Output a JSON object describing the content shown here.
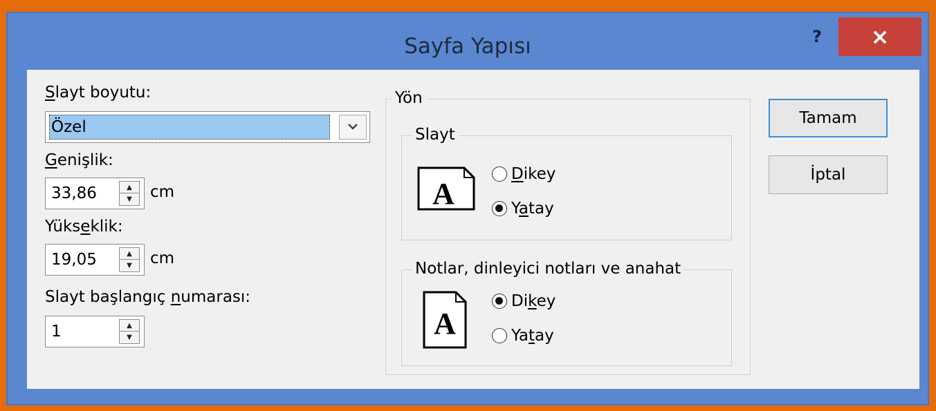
{
  "dialog": {
    "title": "Sayfa Yapısı",
    "help_label": "?",
    "close_label": "×"
  },
  "slide_size": {
    "label_prefix": "S",
    "label_rest": "layt boyutu:",
    "value": "Özel",
    "dropdown_icon": "chevron-down-icon"
  },
  "width": {
    "label_prefix": "G",
    "label_rest": "enişlik:",
    "value": "33,86",
    "unit": "cm"
  },
  "height": {
    "label_a": "Yüks",
    "label_u": "e",
    "label_b": "klik:",
    "value": "19,05",
    "unit": "cm"
  },
  "start_number": {
    "label_a": "Slayt başlangıç ",
    "label_u": "n",
    "label_b": "umarası:",
    "value": "1"
  },
  "orientation": {
    "group_label": "Yön",
    "slide": {
      "group_label": "Slayt",
      "icon_letter": "A",
      "portrait_u": "D",
      "portrait_rest": "ikey",
      "landscape_a": "Y",
      "landscape_u": "a",
      "landscape_b": "tay",
      "selected": "landscape"
    },
    "notes": {
      "group_label": "Notlar, dinleyici notları ve anahat",
      "icon_letter": "A",
      "portrait_a": "Di",
      "portrait_u": "k",
      "portrait_b": "ey",
      "landscape_a": "Ya",
      "landscape_u": "t",
      "landscape_b": "ay",
      "selected": "portrait"
    }
  },
  "buttons": {
    "ok": "Tamam",
    "cancel": "İptal"
  }
}
